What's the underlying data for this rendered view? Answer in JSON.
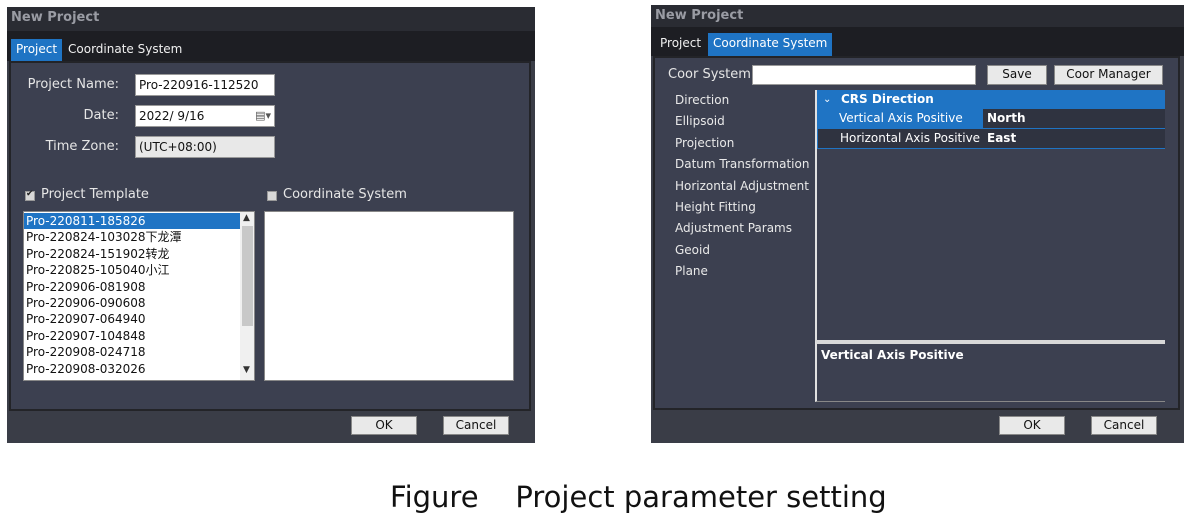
{
  "left": {
    "title": "New Project",
    "tabs": [
      "Project",
      "Coordinate System"
    ],
    "project_name_label": "Project Name:",
    "project_name_value": "Pro-220916-112520",
    "date_label": "Date:",
    "date_value": "2022/  9/16",
    "timezone_label": "Time Zone:",
    "timezone_value": "(UTC+08:00)",
    "template_label": "Project Template",
    "coordsys_label": "Coordinate System",
    "templates": [
      "Pro-220811-185826",
      "Pro-220824-103028下龙潭",
      "Pro-220824-151902转龙",
      "Pro-220825-105040小江",
      "Pro-220906-081908",
      "Pro-220906-090608",
      "Pro-220907-064940",
      "Pro-220907-104848",
      "Pro-220908-024718",
      "Pro-220908-032026"
    ],
    "ok": "OK",
    "cancel": "Cancel"
  },
  "right": {
    "title": "New Project",
    "tabs": [
      "Project",
      "Coordinate System"
    ],
    "coor_label": "Coor System",
    "coor_value": "",
    "save": "Save",
    "coor_manager": "Coor Manager",
    "nav_items": [
      "Direction",
      "Ellipsoid",
      "Projection",
      "Datum Transformation",
      "Horizontal Adjustment",
      "Height Fitting",
      "Adjustment Params",
      "Geoid",
      "Plane"
    ],
    "group": "CRS Direction",
    "props": [
      {
        "name": "Vertical Axis Positive",
        "value": "North"
      },
      {
        "name": "Horizontal Axis Positive",
        "value": "East"
      }
    ],
    "desc": "Vertical Axis Positive",
    "ok": "OK",
    "cancel": "Cancel"
  },
  "caption": "Figure    Project parameter setting"
}
